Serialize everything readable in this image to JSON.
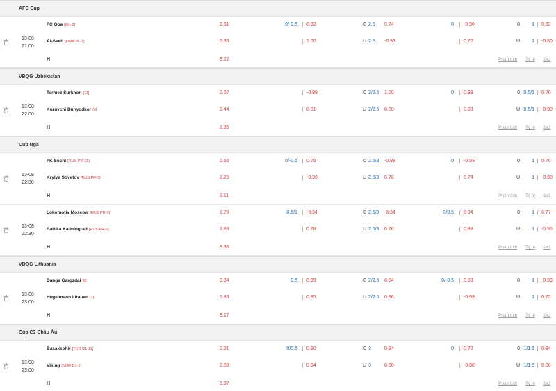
{
  "leagues": [
    {
      "name": "AFC Cup",
      "matches": [
        {
          "date": "13-08",
          "time": "21:00",
          "home": {
            "name": "FC Goa",
            "rank": "[ISL-2]",
            "x12": "2.61",
            "h1": "0/-0.5",
            "h1o": "0.82",
            "ou1": "0",
            "ou1l": "2.5",
            "ou1o": "0.74",
            "h2": "0",
            "h2o": "-0.90",
            "ou2": "0",
            "ou2l": "1",
            "ou2o": "0.62"
          },
          "away": {
            "name": "Al-Seeb",
            "rank": "[OMA PL-1]",
            "x12": "2.33",
            "h1": "",
            "h1o": "1.00",
            "ou1": "U",
            "ou1l": "2.5",
            "ou1o": "-0.93",
            "h2": "",
            "h2o": "0.72",
            "ou2": "U",
            "ou2l": "1",
            "ou2o": "-0.80"
          },
          "draw": "3.22"
        }
      ]
    },
    {
      "name": "VĐQG Uzbekistan",
      "matches": [
        {
          "date": "13-08",
          "time": "22:00",
          "home": {
            "name": "Termez Surkhon",
            "rank": "[11]",
            "x12": "2.67",
            "h1": "",
            "h1o": "-0.99",
            "ou1": "0",
            "ou1l": "2/2.5",
            "ou1o": "1.00",
            "h2": "0",
            "h2o": "0.99",
            "ou2": "0",
            "ou2l": "0.5/1",
            "ou2o": "0.70"
          },
          "away": {
            "name": "Kuruvchi Bunyodkor",
            "rank": "[6]",
            "x12": "2.44",
            "h1": "",
            "h1o": "0.81",
            "ou1": "U",
            "ou1l": "2/2.5",
            "ou1o": "0.80",
            "h2": "",
            "h2o": "0.83",
            "ou2": "U",
            "ou2l": "0.5/1",
            "ou2o": "-0.90"
          },
          "draw": "2.95"
        }
      ]
    },
    {
      "name": "Cup Nga",
      "matches": [
        {
          "date": "13-08",
          "time": "22:30",
          "home": {
            "name": "FK Sochi",
            "rank": "[RUS PR-15]",
            "x12": "2.66",
            "h1": "0/-0.5",
            "h1o": "0.75",
            "ou1": "0",
            "ou1l": "2.5/3",
            "ou1o": "-0.98",
            "h2": "0",
            "h2o": "-0.93",
            "ou2": "0",
            "ou2l": "1",
            "ou2o": "0.70"
          },
          "away": {
            "name": "Krylya Sovetov",
            "rank": "[RUS PR-3]",
            "x12": "2.25",
            "h1": "",
            "h1o": "-0.93",
            "ou1": "U",
            "ou1l": "2.5/3",
            "ou1o": "0.78",
            "h2": "",
            "h2o": "0.74",
            "ou2": "U",
            "ou2l": "1",
            "ou2o": "-0.90"
          },
          "draw": "3.11"
        },
        {
          "date": "13-08",
          "time": "22:30",
          "home": {
            "name": "Lokomotiv Moscow",
            "rank": "[RUS PR-1]",
            "x12": "1.78",
            "h1": "0.5/1",
            "h1o": "-0.94",
            "ou1": "0",
            "ou1l": "2.5/3",
            "ou1o": "-0.94",
            "h2": "0/0.5",
            "h2o": "0.94",
            "ou2": "0",
            "ou2l": "1",
            "ou2o": "0.77"
          },
          "away": {
            "name": "Baltika Kaliningrad",
            "rank": "[RUS PR-5]",
            "x12": "3.83",
            "h1": "",
            "h1o": "0.78",
            "ou1": "U",
            "ou1l": "2.5/3",
            "ou1o": "0.76",
            "h2": "",
            "h2o": "0.88",
            "ou2": "U",
            "ou2l": "1",
            "ou2o": "-0.95"
          },
          "draw": "3.36"
        }
      ]
    },
    {
      "name": "VĐQG Lithuania",
      "matches": [
        {
          "date": "13-08",
          "time": "23:00",
          "home": {
            "name": "Banga Gargzdai",
            "rank": "[8]",
            "x12": "3.84",
            "h1": "-0.5",
            "h1o": "0.99",
            "ou1": "0",
            "ou1l": "2/2.5",
            "ou1o": "0.84",
            "h2": "0/-0.5",
            "h2o": "0.83",
            "ou2": "0",
            "ou2l": "1",
            "ou2o": "-0.93"
          },
          "away": {
            "name": "Hegelmann Litauen",
            "rank": "[2]",
            "x12": "1.83",
            "h1": "",
            "h1o": "0.85",
            "ou1": "U",
            "ou1l": "2/2.5",
            "ou1o": "0.96",
            "h2": "",
            "h2o": "-0.99",
            "ou2": "U",
            "ou2l": "1",
            "ou2o": "0.72"
          },
          "draw": "3.17"
        }
      ]
    },
    {
      "name": "Cúp C3 Châu Âu",
      "matches": [
        {
          "date": "13-08",
          "time": "23:00",
          "home": {
            "name": "Basaksehir",
            "rank": "[TUR D1-11]",
            "x12": "2.21",
            "h1": "0/0.5",
            "h1o": "0.90",
            "ou1": "0",
            "ou1l": "3",
            "ou1o": "0.94",
            "h2": "0",
            "h2o": "0.72",
            "ou2": "0",
            "ou2l": "1/1.5",
            "ou2o": "0.94"
          },
          "away": {
            "name": "Viking",
            "rank": "[NOR D1-1]",
            "x12": "2.68",
            "h1": "",
            "h1o": "0.94",
            "ou1": "U",
            "ou1l": "3",
            "ou1o": "0.88",
            "h2": "",
            "h2o": "-0.88",
            "ou2": "U",
            "ou2l": "1/1.5",
            "ou2o": "0.88"
          },
          "draw": "3.37"
        }
      ]
    }
  ],
  "labels": {
    "draw": "H",
    "analysis": "Phân tích",
    "odds": "Tỷ lệ",
    "x12": "1x2"
  },
  "colors": {
    "odds_red": "#e53935",
    "line_blue": "#1565c0",
    "league_bg": "#f2f2f2"
  }
}
